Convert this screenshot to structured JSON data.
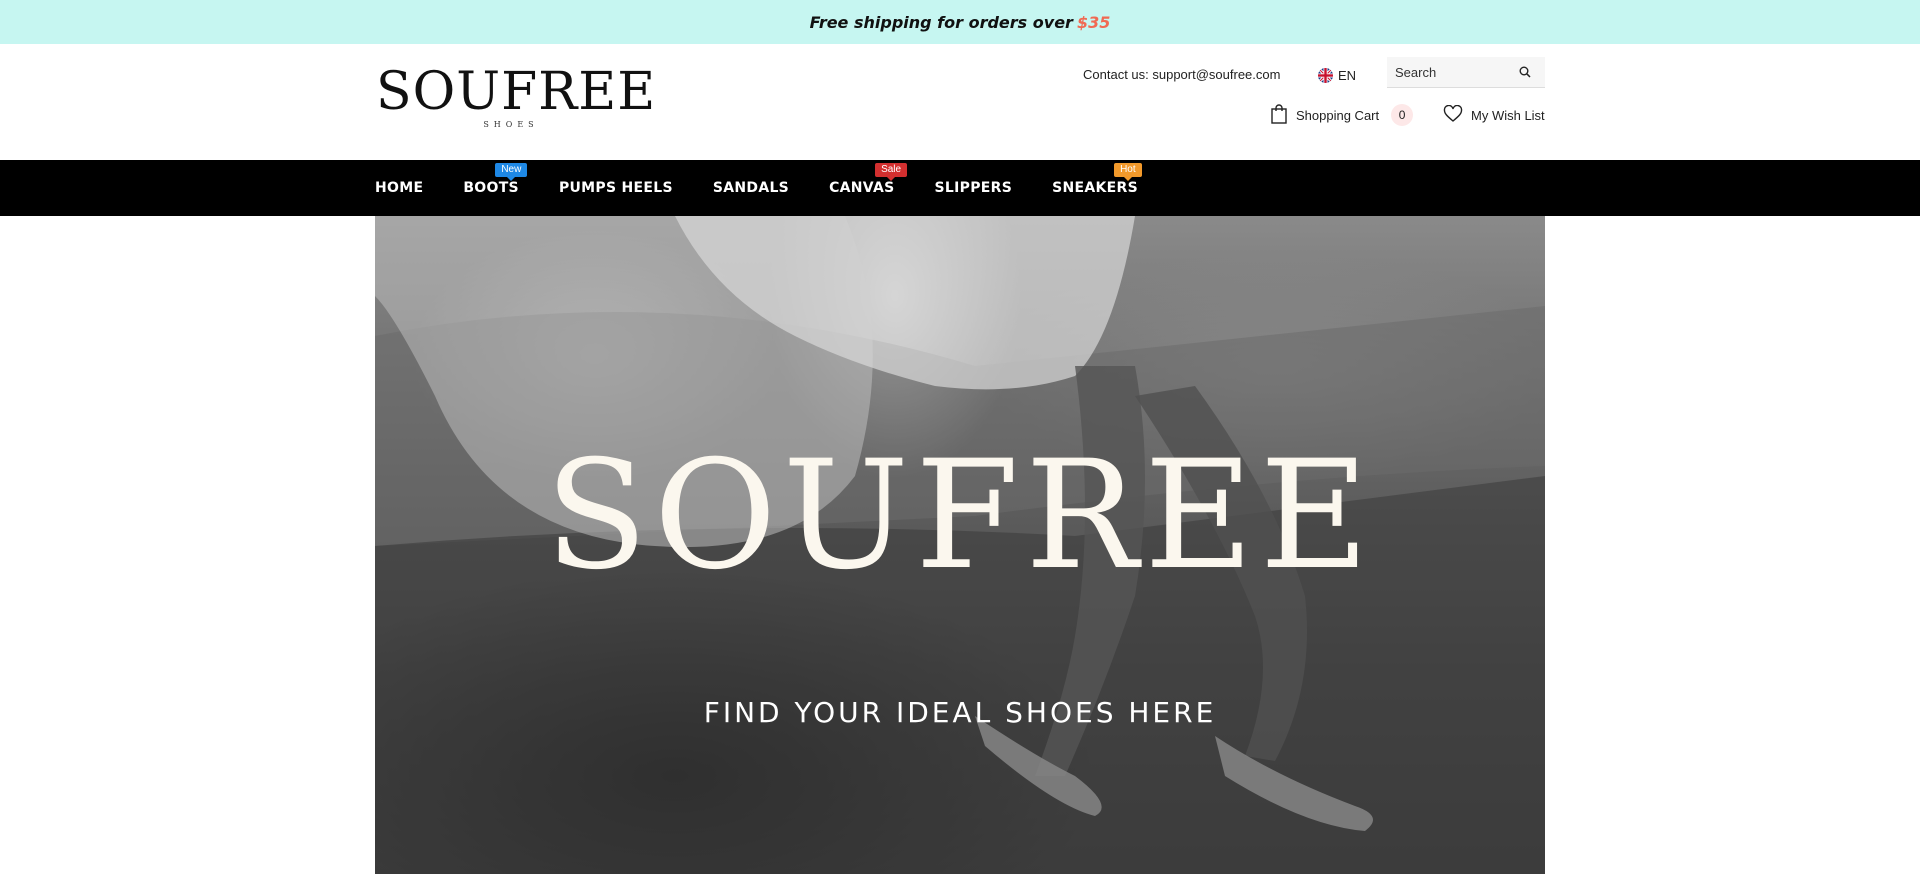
{
  "announcement": {
    "text": "Free shipping for orders over",
    "price": "$35"
  },
  "header": {
    "logo_text": "SOUFREE",
    "logo_sub": "SHOES",
    "contact": "Contact us: support@soufree.com",
    "language": "EN",
    "search_placeholder": "Search",
    "cart_label": "Shopping Cart",
    "cart_count": "0",
    "wishlist_label": "My Wish List"
  },
  "nav": {
    "items": [
      {
        "label": "HOME",
        "badge": ""
      },
      {
        "label": "BOOTS",
        "badge": "New"
      },
      {
        "label": "PUMPS HEELS",
        "badge": ""
      },
      {
        "label": "SANDALS",
        "badge": ""
      },
      {
        "label": "CANVAS",
        "badge": "Sale"
      },
      {
        "label": "SLIPPERS",
        "badge": ""
      },
      {
        "label": "SNEAKERS",
        "badge": "Hot"
      }
    ]
  },
  "hero": {
    "title": "SOUFREE",
    "subtitle": "FIND YOUR IDEAL SHOES HERE"
  },
  "colors": {
    "announcement_bg": "#c6f6f1",
    "price_accent": "#f06a53",
    "nav_bg": "#000000",
    "badge_new": "#1e88e5",
    "badge_sale": "#d32f2f",
    "badge_hot": "#f39a2b"
  }
}
